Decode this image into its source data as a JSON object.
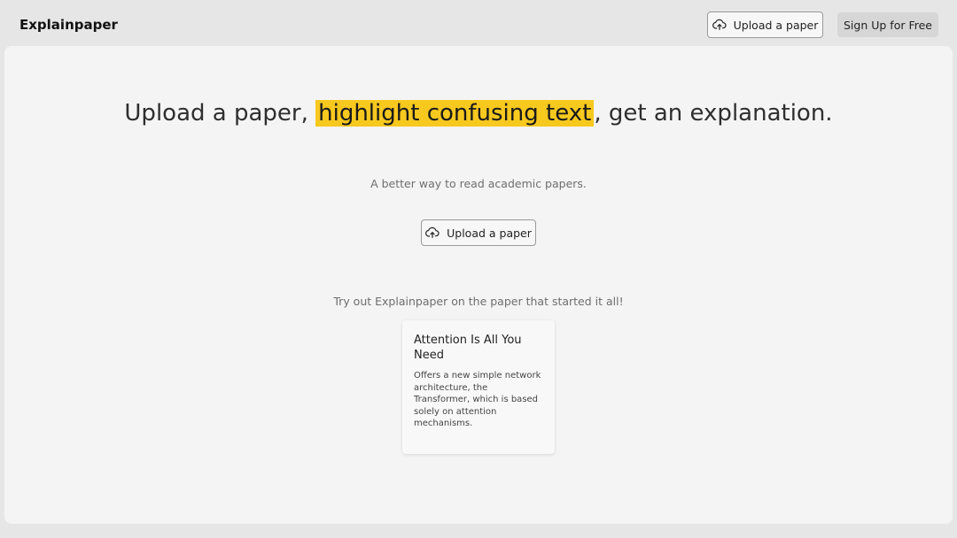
{
  "app": {
    "brand": "Explainpaper"
  },
  "nav": {
    "upload_label": "Upload a paper",
    "signup_label": "Sign Up for Free",
    "upload_icon": "cloud-upload-icon"
  },
  "hero": {
    "headline_pre": "Upload a paper, ",
    "headline_highlight": "highlight confusing text",
    "headline_post": ", get an explanation.",
    "subtitle": "A better way to read academic papers.",
    "upload_label": "Upload a paper",
    "highlight_color": "#f7c81e"
  },
  "sample": {
    "prompt": "Try out Explainpaper on the paper that started it all!",
    "card": {
      "title": "Attention Is All You Need",
      "description": "Offers a new simple network architecture, the Transformer, which is based solely on attention mechanisms."
    }
  }
}
